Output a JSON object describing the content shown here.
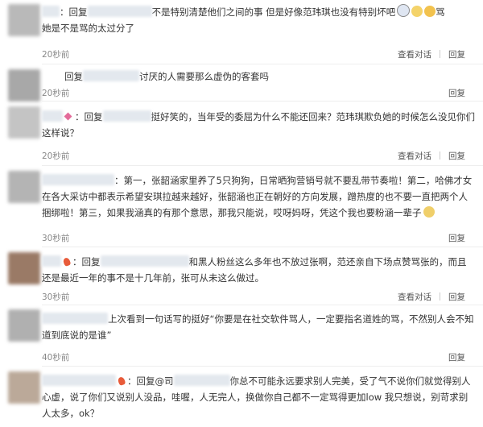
{
  "comments": [
    {
      "reply_prefix": "：回复",
      "text": "不是特别清楚他们之间的事 但是好像范玮琪也没有特别坏吧",
      "trail": "骂",
      "line2": "她是不是骂的太过分了",
      "time": "20秒前",
      "view_label": "查看对话",
      "reply_label": "回复"
    },
    {
      "reply_prefix": "回复",
      "text": "讨厌的人需要那么虚伪的客套吗",
      "time": "20秒前",
      "reply_label": "回复"
    },
    {
      "reply_prefix": "：回复",
      "text": "挺好笑的，当年受的委屈为什么不能还回来？范玮琪欺负她的时候怎么没见你们这样说？",
      "time": "20秒前",
      "view_label": "查看对话",
      "reply_label": "回复"
    },
    {
      "text": "：第一，张韶涵家里养了5只狗狗，日常晒狗营销号就不要乱带节奏啦！第二，哈佛才女在各大采访中都表示希望安琪拉越来越好，张韶涵也正在朝好的方向发展，蹭热度的也不要一直把两个人捆绑啦！第三，如果我涵真的有那个意思，那我只能说，哎呀妈呀，凭这个我也要粉涵一辈子",
      "time": "30秒前",
      "reply_label": "回复"
    },
    {
      "reply_prefix": "：回复",
      "text": "和黑人粉丝这么多年也不放过张啊，范还亲自下场点赞骂张的，而且还是最近一年的事不是十几年前，张可从未这么做过。",
      "time": "30秒前",
      "view_label": "查看对话",
      "reply_label": "回复"
    },
    {
      "text": "上次看到一句话写的挺好“你要是在社交软件骂人，一定要指名道姓的骂，不然别人会不知道到底说的是谁”",
      "time": "40秒前",
      "reply_label": "回复"
    },
    {
      "reply_prefix": "：回复@司",
      "text": "你总不可能永远要求别人完美，受了气不说你们就觉得别人心虚，说了你们又说别人没品，哇喔，人无完人，换做你自己都不一定骂得更加low 我只想说，别苛求别人太多，ok？"
    }
  ],
  "colors": {
    "link": "#2a5db0",
    "text": "#333333",
    "meta": "#888888"
  },
  "icons": [
    "flame-icon",
    "heart-icon",
    "emoji-icon"
  ]
}
